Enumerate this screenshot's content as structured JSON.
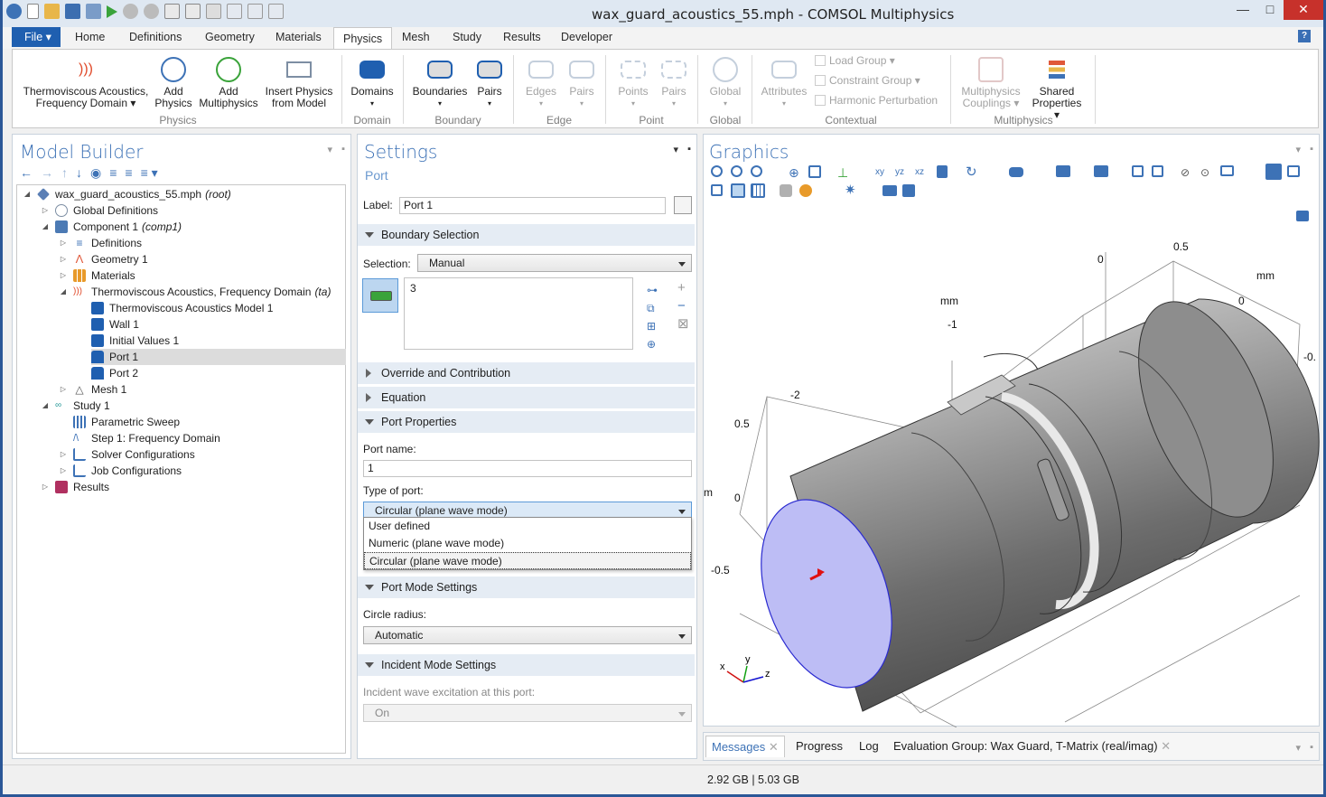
{
  "window": {
    "title": "wax_guard_acoustics_55.mph - COMSOL Multiphysics"
  },
  "ribbon_tabs": [
    "File ▾",
    "Home",
    "Definitions",
    "Geometry",
    "Materials",
    "Physics",
    "Mesh",
    "Study",
    "Results",
    "Developer"
  ],
  "ribbon": {
    "physics_group": {
      "btn1": "Thermoviscous Acoustics,",
      "btn1b": "Frequency Domain ▾",
      "btn2": "Add",
      "btn2b": "Physics",
      "btn3": "Add",
      "btn3b": "Multiphysics",
      "btn4": "Insert Physics",
      "btn4b": "from Model",
      "label": "Physics"
    },
    "domain_group": {
      "btn": "Domains",
      "label": "Domain"
    },
    "boundary_group": {
      "btn1": "Boundaries",
      "btn2": "Pairs",
      "label": "Boundary"
    },
    "edge_group": {
      "btn1": "Edges",
      "btn2": "Pairs",
      "label": "Edge"
    },
    "point_group": {
      "btn1": "Points",
      "btn2": "Pairs",
      "label": "Point"
    },
    "global_group": {
      "btn": "Global",
      "label": "Global"
    },
    "contextual_group": {
      "attributes": "Attributes",
      "load_group": "Load Group ▾",
      "constraint_group": "Constraint Group ▾",
      "harmonic": "Harmonic Perturbation",
      "label": "Contextual"
    },
    "multiphysics_group": {
      "btn1": "Multiphysics",
      "btn1b": "Couplings ▾",
      "btn2": "Shared",
      "btn2b": "Properties ▾",
      "label": "Multiphysics"
    }
  },
  "model_builder": {
    "title": "Model Builder",
    "tree": [
      {
        "label": "wax_guard_acoustics_55.mph",
        "tag": "(root)"
      },
      {
        "label": "Global Definitions",
        "tag": ""
      },
      {
        "label": "Component 1",
        "tag": "(comp1)"
      },
      {
        "label": "Definitions",
        "tag": ""
      },
      {
        "label": "Geometry 1",
        "tag": ""
      },
      {
        "label": "Materials",
        "tag": ""
      },
      {
        "label": "Thermoviscous Acoustics, Frequency Domain",
        "tag": "(ta)"
      },
      {
        "label": "Thermoviscous Acoustics Model 1",
        "tag": ""
      },
      {
        "label": "Wall 1",
        "tag": ""
      },
      {
        "label": "Initial Values 1",
        "tag": ""
      },
      {
        "label": "Port 1",
        "tag": ""
      },
      {
        "label": "Port 2",
        "tag": ""
      },
      {
        "label": "Mesh 1",
        "tag": ""
      },
      {
        "label": "Study 1",
        "tag": ""
      },
      {
        "label": "Parametric Sweep",
        "tag": ""
      },
      {
        "label": "Step 1: Frequency Domain",
        "tag": ""
      },
      {
        "label": "Solver Configurations",
        "tag": ""
      },
      {
        "label": "Job Configurations",
        "tag": ""
      },
      {
        "label": "Results",
        "tag": ""
      }
    ]
  },
  "settings": {
    "title": "Settings",
    "subtitle": "Port",
    "label_caption": "Label:",
    "label_value": "Port 1",
    "sec_boundary": "Boundary Selection",
    "selection_caption": "Selection:",
    "selection_value": "Manual",
    "selection_list": "3",
    "sec_override": "Override and Contribution",
    "sec_equation": "Equation",
    "sec_port_props": "Port Properties",
    "port_name_caption": "Port name:",
    "port_name_value": "1",
    "type_caption": "Type of port:",
    "type_value": "Circular (plane wave mode)",
    "type_options": [
      "User defined",
      "Numeric (plane wave mode)",
      "Circular (plane wave mode)"
    ],
    "sec_mode": "Port Mode Settings",
    "radius_caption": "Circle radius:",
    "radius_value": "Automatic",
    "sec_incident": "Incident Mode Settings",
    "incident_caption": "Incident wave excitation at this port:",
    "incident_value": "On"
  },
  "graphics": {
    "title": "Graphics",
    "axis_labels": {
      "t1": "0.5",
      "t2": "0",
      "t3": "mm",
      "t4": "0",
      "t5": "-0.",
      "t6": "mm",
      "t7": "-1",
      "t8": "-2",
      "t9": "0.5",
      "t10": "0",
      "t11": "-0.5",
      "t12": "m"
    },
    "triad": {
      "x": "x",
      "y": "y",
      "z": "z"
    }
  },
  "bottom_tabs": [
    "Messages",
    "Progress",
    "Log",
    "Evaluation Group: Wax Guard, T-Matrix (real/imag)"
  ],
  "status": {
    "memory": "2.92 GB | 5.03 GB"
  },
  "colors": {
    "accent": "#3d72b6",
    "file_tab": "#1f5fb0",
    "port_face": "#bdbdf5"
  }
}
